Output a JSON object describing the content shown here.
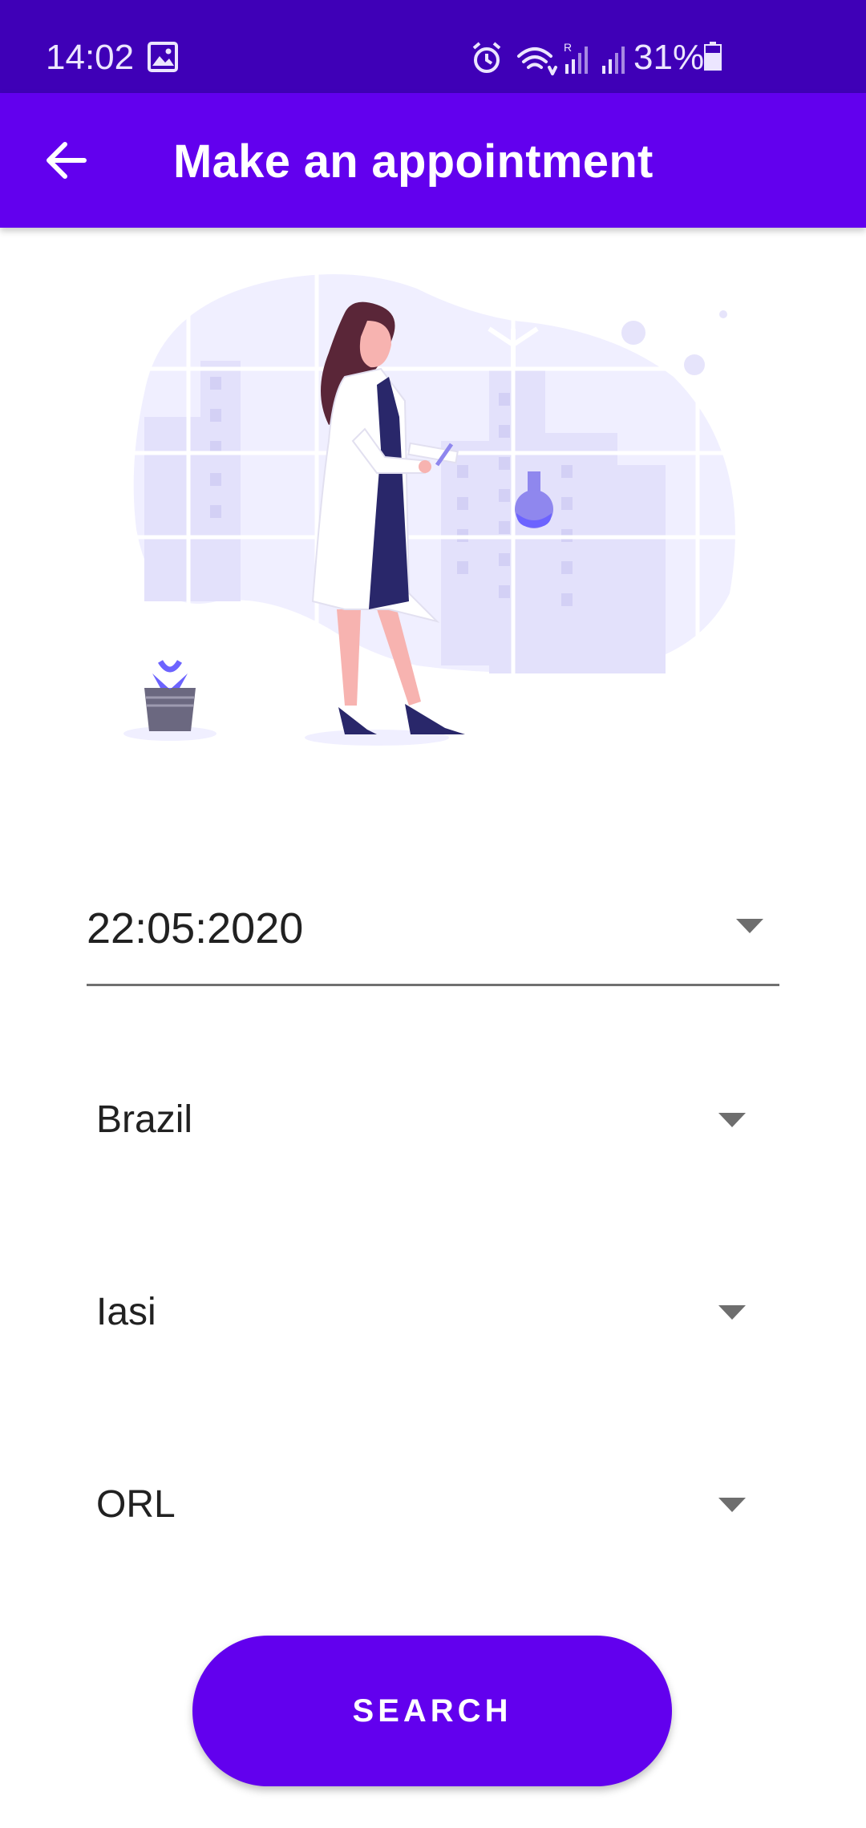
{
  "status_bar": {
    "time": "14:02",
    "battery_percent": "31%",
    "icons": [
      "gallery-icon",
      "alarm-icon",
      "wifi-icon",
      "signal-icon",
      "battery-icon"
    ]
  },
  "app_bar": {
    "title": "Make an appointment",
    "back_icon": "arrow-back-icon"
  },
  "form": {
    "date": "22:05:2020",
    "country": "Brazil",
    "city": "Iasi",
    "specialty": "ORL"
  },
  "actions": {
    "search_label": "SEARCH"
  },
  "colors": {
    "status_bar": "#3f00b7",
    "primary": "#6200ee",
    "illustration_bg": "#f0efff"
  }
}
